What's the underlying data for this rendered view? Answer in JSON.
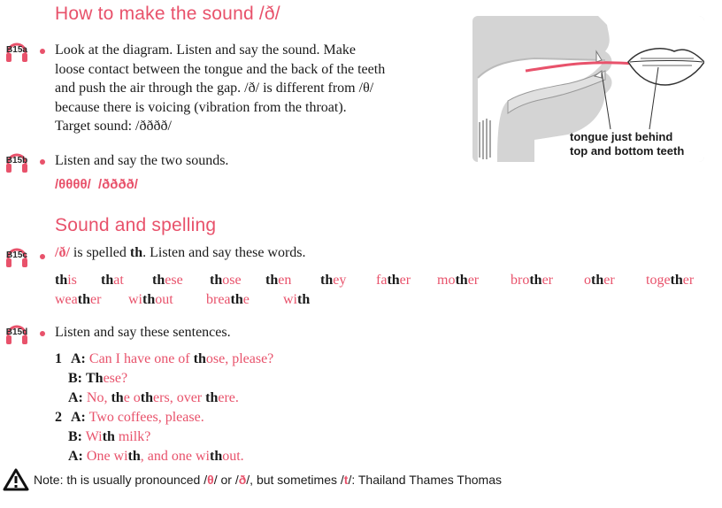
{
  "section1": {
    "heading": "How to make the sound /ð/",
    "track_a": "B15a",
    "para_line1": "Look at the diagram. Listen and say the sound. Make",
    "para_line2": "loose contact between the tongue and the back of the teeth",
    "para_line3": "and push the air through the gap. /ð/ is different from /θ/",
    "para_line4": "because there is voicing (vibration from the throat).",
    "para_line5": "Target sound: /ðððð/",
    "track_b": "B15b",
    "listen_two": "Listen and say the two sounds.",
    "sounds_a": "/θθθθ/",
    "sounds_b": "/ðððð/"
  },
  "diagram": {
    "label_line1": "tongue just behind",
    "label_line2": "top and bottom teeth"
  },
  "section2": {
    "heading": "Sound and spelling",
    "track_c": "B15c",
    "intro_a": "/ð/",
    "intro_b": " is spelled ",
    "intro_c": "th",
    "intro_d": ". Listen and say these words.",
    "words": [
      [
        "th",
        "is"
      ],
      [
        "th",
        "at"
      ],
      [
        "th",
        "ese"
      ],
      [
        "th",
        "ose"
      ],
      [
        "th",
        "en"
      ],
      [
        "th",
        "ey"
      ],
      [
        "fa",
        "th",
        "er"
      ],
      [
        "mo",
        "th",
        "er"
      ],
      [
        "bro",
        "th",
        "er"
      ],
      [
        "o",
        "th",
        "er"
      ],
      [
        "toge",
        "th",
        "er"
      ],
      [
        "wea",
        "th",
        "er"
      ],
      [
        "wi",
        "th",
        "out"
      ],
      [
        "brea",
        "th",
        "e"
      ],
      [
        "wi",
        "th"
      ]
    ],
    "track_d": "B15d",
    "listen_sentences": "Listen and say these sentences."
  },
  "dialogue": {
    "n1": "1",
    "l1_spk": "A:",
    "l1_a": "Can I have one of ",
    "l1_b": "th",
    "l1_c": "ose, please?",
    "l2_spk": "B:",
    "l2_a": "Th",
    "l2_b": "ese?",
    "l3_spk": "A:",
    "l3_a": "No, ",
    "l3_b": "th",
    "l3_c": "e o",
    "l3_d": "th",
    "l3_e": "ers, over ",
    "l3_f": "th",
    "l3_g": "ere.",
    "n2": "2",
    "l4_spk": "A:",
    "l4_a": "Two coffees, please.",
    "l5_spk": "B:",
    "l5_a": "Wi",
    "l5_b": "th",
    "l5_c": " milk?",
    "l6_spk": "A:",
    "l6_a": "One wi",
    "l6_b": "th",
    "l6_c": ", and one wi",
    "l6_d": "th",
    "l6_e": "out."
  },
  "note": {
    "prefix": "Note: th is usually pronounced /",
    "s1": "θ",
    "mid1": "/ or /",
    "s2": "ð",
    "mid2": "/, but sometimes /",
    "s3": "t",
    "suffix": "/: Thailand Thames Thomas"
  },
  "colors": {
    "accent": "#e8526b",
    "diagram_bg": "#d4d4d4"
  }
}
